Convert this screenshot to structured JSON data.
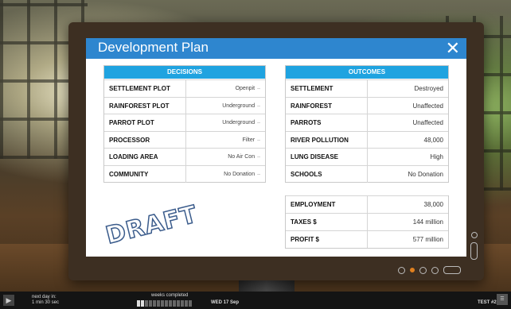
{
  "dialog": {
    "title": "Development Plan",
    "close_symbol": "✕"
  },
  "decisions": {
    "header": "DECISIONS",
    "rows": [
      {
        "label": "SETTLEMENT PLOT",
        "value": "Openpit"
      },
      {
        "label": "RAINFOREST PLOT",
        "value": "Underground"
      },
      {
        "label": "PARROT PLOT",
        "value": "Underground"
      },
      {
        "label": "PROCESSOR",
        "value": "Filter"
      },
      {
        "label": "LOADING AREA",
        "value": "No Air Con"
      },
      {
        "label": "COMMUNITY",
        "value": "No Donation"
      }
    ]
  },
  "outcomes": {
    "header": "OUTCOMES",
    "rows": [
      {
        "label": "SETTLEMENT",
        "value": "Destroyed"
      },
      {
        "label": "RAINFOREST",
        "value": "Unaffected"
      },
      {
        "label": "PARROTS",
        "value": "Unaffected"
      },
      {
        "label": "RIVER POLLUTION",
        "value": "48,000"
      },
      {
        "label": "LUNG DISEASE",
        "value": "High"
      },
      {
        "label": "SCHOOLS",
        "value": "No Donation"
      }
    ]
  },
  "economics": {
    "rows": [
      {
        "label": "EMPLOYMENT",
        "value": "38,000"
      },
      {
        "label": "TAXES $",
        "value": "144 million"
      },
      {
        "label": "PROFIT $",
        "value": "577 million"
      }
    ]
  },
  "stamp": "DRAFT",
  "caret_symbol": "–",
  "bottom_bar": {
    "play_icon": "play-icon",
    "next_day_label": "next day in:",
    "next_day_time": "1 min 30 sec",
    "weeks_label": "weeks completed",
    "weeks_completed": 2,
    "weeks_total": 14,
    "date": "WED 17 Sep",
    "test_label": "TEST #2"
  },
  "colors": {
    "titlebar": "#2e86cf",
    "table_header": "#1fa3e0",
    "active_dot": "#e0801f"
  }
}
